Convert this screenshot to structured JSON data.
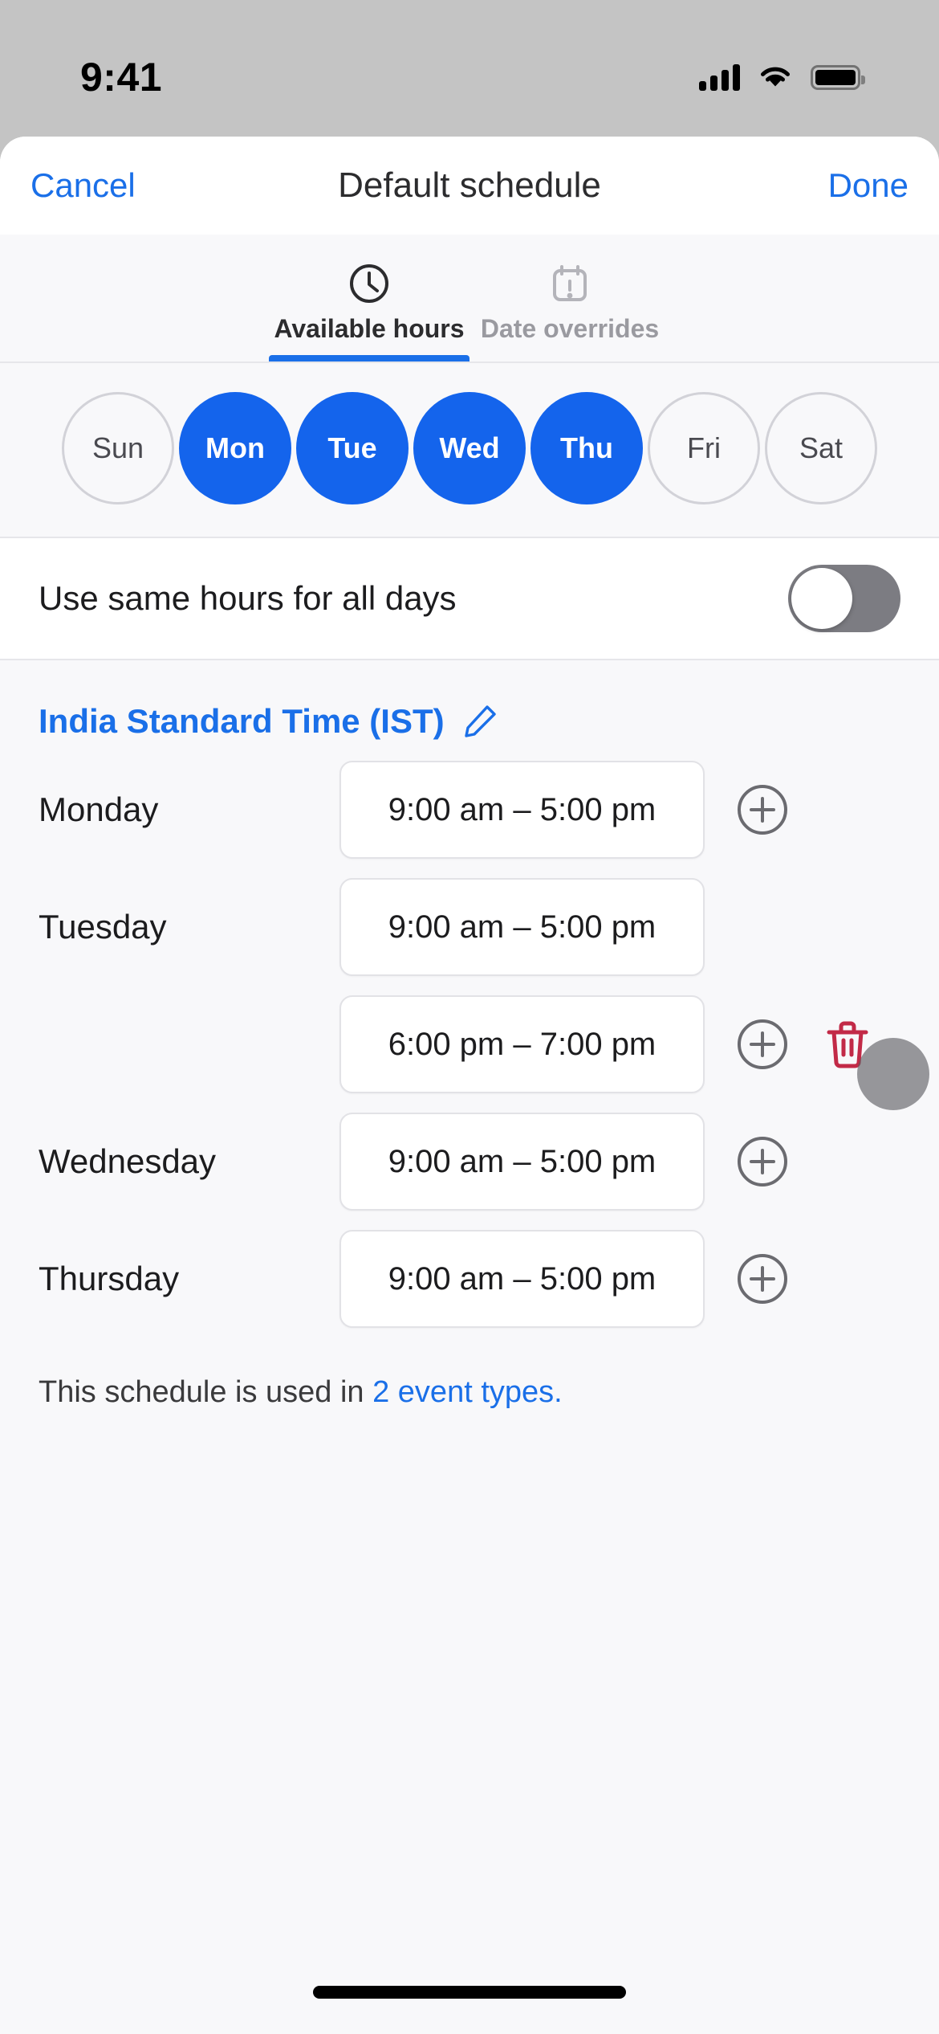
{
  "status_bar": {
    "time": "9:41",
    "cellular_icon": "signal-bars-icon",
    "wifi_icon": "wifi-icon",
    "battery_icon": "battery-icon"
  },
  "nav": {
    "cancel_label": "Cancel",
    "title": "Default schedule",
    "done_label": "Done"
  },
  "tabs": [
    {
      "label": "Available hours",
      "icon": "clock-icon",
      "active": true
    },
    {
      "label": "Date overrides",
      "icon": "calendar-alert-icon",
      "active": false
    }
  ],
  "day_chips": [
    {
      "label": "Sun",
      "selected": false
    },
    {
      "label": "Mon",
      "selected": true
    },
    {
      "label": "Tue",
      "selected": true
    },
    {
      "label": "Wed",
      "selected": true
    },
    {
      "label": "Thu",
      "selected": true
    },
    {
      "label": "Fri",
      "selected": false
    },
    {
      "label": "Sat",
      "selected": false
    }
  ],
  "same_hours": {
    "label": "Use same hours for all days",
    "enabled": false
  },
  "timezone": {
    "label": "India Standard Time (IST)",
    "edit_icon": "pencil-icon"
  },
  "schedule_rows": [
    {
      "day": "Monday",
      "slots": [
        {
          "time": "9:00 am – 5:00 pm",
          "has_add": true,
          "has_delete": false
        }
      ]
    },
    {
      "day": "Tuesday",
      "slots": [
        {
          "time": "9:00 am – 5:00 pm",
          "has_add": false,
          "has_delete": false
        },
        {
          "time": "6:00 pm – 7:00 pm",
          "has_add": true,
          "has_delete": true
        }
      ]
    },
    {
      "day": "Wednesday",
      "slots": [
        {
          "time": "9:00 am – 5:00 pm",
          "has_add": true,
          "has_delete": false
        }
      ]
    },
    {
      "day": "Thursday",
      "slots": [
        {
          "time": "9:00 am – 5:00 pm",
          "has_add": true,
          "has_delete": false
        }
      ]
    }
  ],
  "footer": {
    "text_before": "This schedule is used in ",
    "link_text": "2 event types."
  },
  "colors": {
    "accent_blue": "#1464ec",
    "link_blue": "#1a6fe8",
    "delete_red": "#c22a47",
    "inactive_gray": "#9a9aa0",
    "toggle_off": "#7c7c82"
  },
  "icons": {
    "add_slot": "plus-circle-icon",
    "delete_slot": "trash-icon",
    "home_indicator": "home-indicator"
  }
}
